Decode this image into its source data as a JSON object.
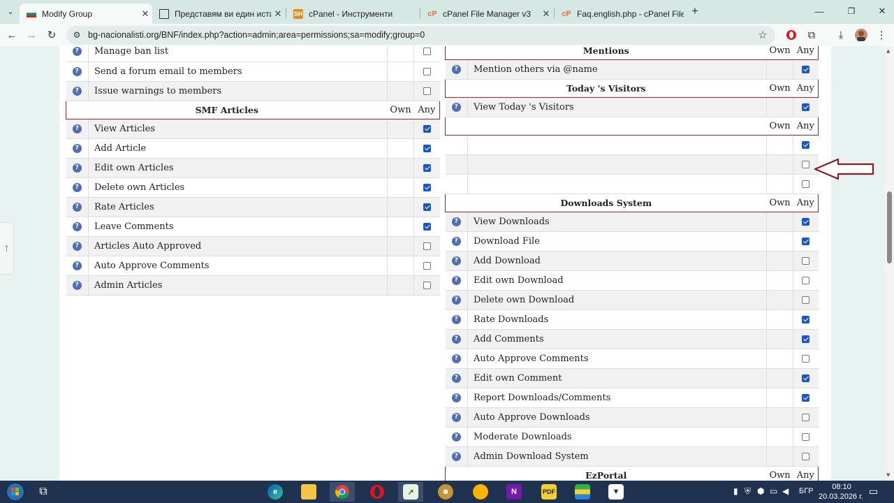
{
  "browser": {
    "tabs": [
      {
        "title": "Modify Group",
        "fav_color": "#2e8b57",
        "active": true
      },
      {
        "title": "Представям ви един истински",
        "fav_color": "#333333",
        "active": false
      },
      {
        "title": "cPanel - Инструменти",
        "fav_color": "#e58a1f",
        "active": false
      },
      {
        "title": "cPanel File Manager v3",
        "fav_color": "#ff6c2c",
        "active": false
      },
      {
        "title": "Faq.english.php - cPanel File M",
        "fav_color": "#ff6c2c",
        "active": false
      }
    ],
    "url": "bg-nacionalisti.org/BNF/index.php?action=admin;area=permissions;sa=modify;group=0"
  },
  "left_panel": {
    "rows_top": [
      {
        "label": "Manage ban list",
        "any": false
      },
      {
        "label": "Send a forum email to members",
        "any": false
      },
      {
        "label": "Issue warnings to members",
        "any": false
      }
    ],
    "smf_articles": {
      "title": "SMF Articles",
      "own": "Own",
      "any": "Any",
      "rows": [
        {
          "label": "View Articles",
          "any": true
        },
        {
          "label": "Add Article",
          "any": true
        },
        {
          "label": "Edit own Articles",
          "any": true
        },
        {
          "label": "Delete own Articles",
          "any": true
        },
        {
          "label": "Rate Articles",
          "any": true
        },
        {
          "label": "Leave Comments",
          "any": true
        },
        {
          "label": "Articles Auto Approved",
          "any": false
        },
        {
          "label": "Auto Approve Comments",
          "any": false
        },
        {
          "label": "Admin Articles",
          "any": false
        }
      ]
    }
  },
  "right_panel": {
    "mentions": {
      "title": "Mentions",
      "own": "Own",
      "any": "Any",
      "rows": [
        {
          "label": "Mention others via @name",
          "any": true
        }
      ]
    },
    "todays_visitors": {
      "title": "Today 's Visitors",
      "own": "Own",
      "any": "Any",
      "rows": [
        {
          "label": "View Today 's Visitors",
          "any": true
        }
      ]
    },
    "unnamed": {
      "title": "",
      "own": "Own",
      "any": "Any",
      "rows": [
        {
          "label": "",
          "any": true
        },
        {
          "label": "",
          "any": false
        },
        {
          "label": "",
          "any": false
        }
      ]
    },
    "downloads": {
      "title": "Downloads System",
      "own": "Own",
      "any": "Any",
      "rows": [
        {
          "label": "View Downloads",
          "any": true
        },
        {
          "label": "Download File",
          "any": true
        },
        {
          "label": "Add Download",
          "any": false
        },
        {
          "label": "Edit own Download",
          "any": false
        },
        {
          "label": "Delete own Download",
          "any": false
        },
        {
          "label": "Rate Downloads",
          "any": true
        },
        {
          "label": "Add Comments",
          "any": true
        },
        {
          "label": "Auto Approve Comments",
          "any": false
        },
        {
          "label": "Edit own Comment",
          "any": true
        },
        {
          "label": "Report Downloads/Comments",
          "any": true
        },
        {
          "label": "Auto Approve Downloads",
          "any": false
        },
        {
          "label": "Moderate Downloads",
          "any": false
        },
        {
          "label": "Admin Download System",
          "any": false
        }
      ]
    },
    "ezportal": {
      "title": "EzPortal",
      "own": "Own",
      "any": "Any"
    }
  },
  "taskbar": {
    "time": "08:10",
    "date": "20.03.2026 г.",
    "language": "БГР"
  },
  "colors": {
    "accent_border": "#a2232f",
    "checkbox_on": "#1a57c4",
    "arrow": "#8b1a22"
  }
}
